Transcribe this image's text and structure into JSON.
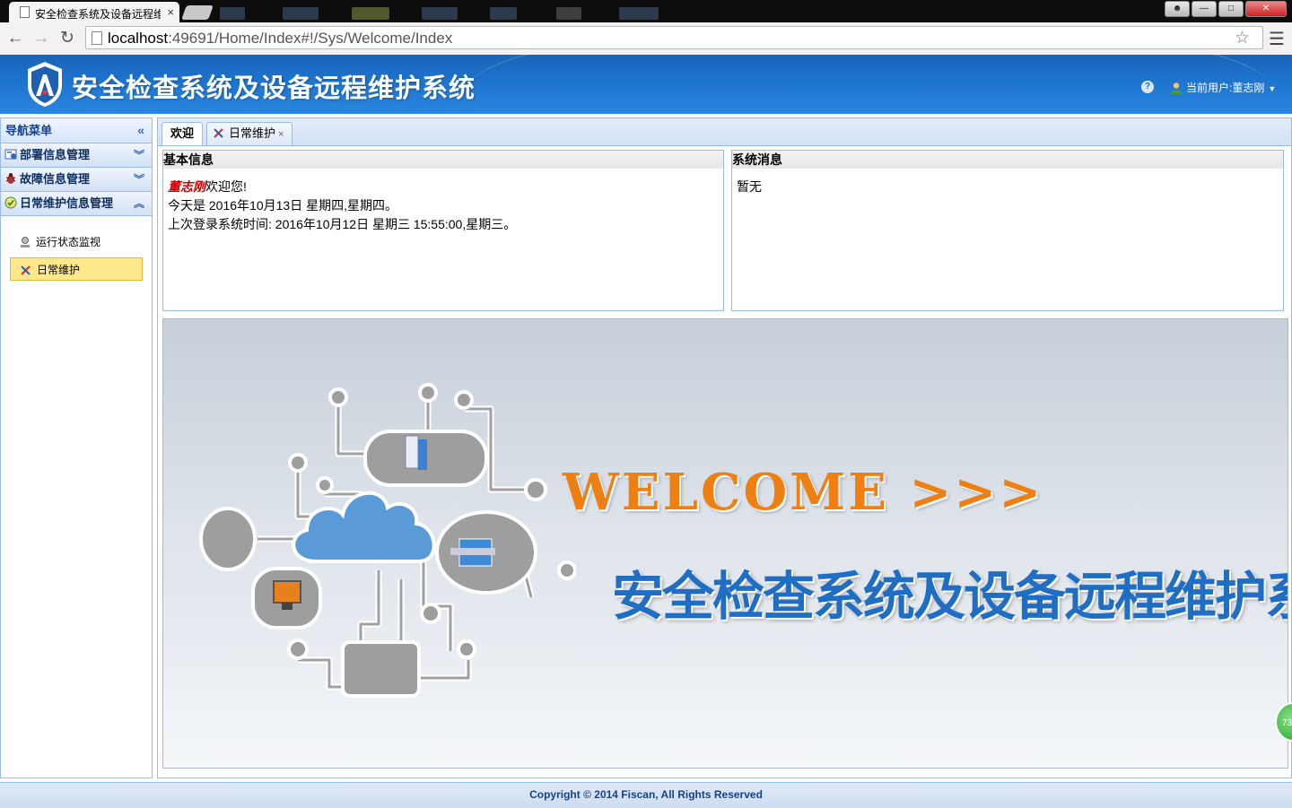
{
  "browser": {
    "tab_title": "安全检查系统及设备远程维",
    "tab_close": "×",
    "url_host": "localhost",
    "url_rest": ":49691/Home/Index#!/Sys/Welcome/Index"
  },
  "header": {
    "title": "安全检查系统及设备远程维护系统",
    "help": "?",
    "user_label": "当前用户:董志刚",
    "user_caret": "▼"
  },
  "sidebar": {
    "title": "导航菜单",
    "collapse": "«",
    "groups": [
      {
        "label": "部署信息管理",
        "chev": "︾"
      },
      {
        "label": "故障信息管理",
        "chev": "︾"
      },
      {
        "label": "日常维护信息管理",
        "chev": "︽"
      }
    ],
    "items": [
      {
        "label": "运行状态监视"
      },
      {
        "label": "日常维护"
      }
    ]
  },
  "tabs": {
    "welcome": "欢迎",
    "maint": "日常维护",
    "maint_close": "×"
  },
  "basic_info": {
    "header": "基本信息",
    "user": "董志刚",
    "greeting": "欢迎您!",
    "today": "今天是 2016年10月13日 星期四,星期四。",
    "last_login": "上次登录系统时间: 2016年10月12日 星期三 15:55:00,星期三。"
  },
  "system_msg": {
    "header": "系统消息",
    "content": "暂无"
  },
  "banner": {
    "welcome": "WELCOME >>>",
    "title": "安全检查系统及设备远程维护系统"
  },
  "float_badge": "73",
  "footer": "Copyright © 2014 Fiscan, All Rights Reserved",
  "colors": {
    "header_blue": "#1d72cc",
    "welcome_orange": "#f07f12",
    "title_blue": "#1f6ec3",
    "selected_item": "#fde88b"
  }
}
